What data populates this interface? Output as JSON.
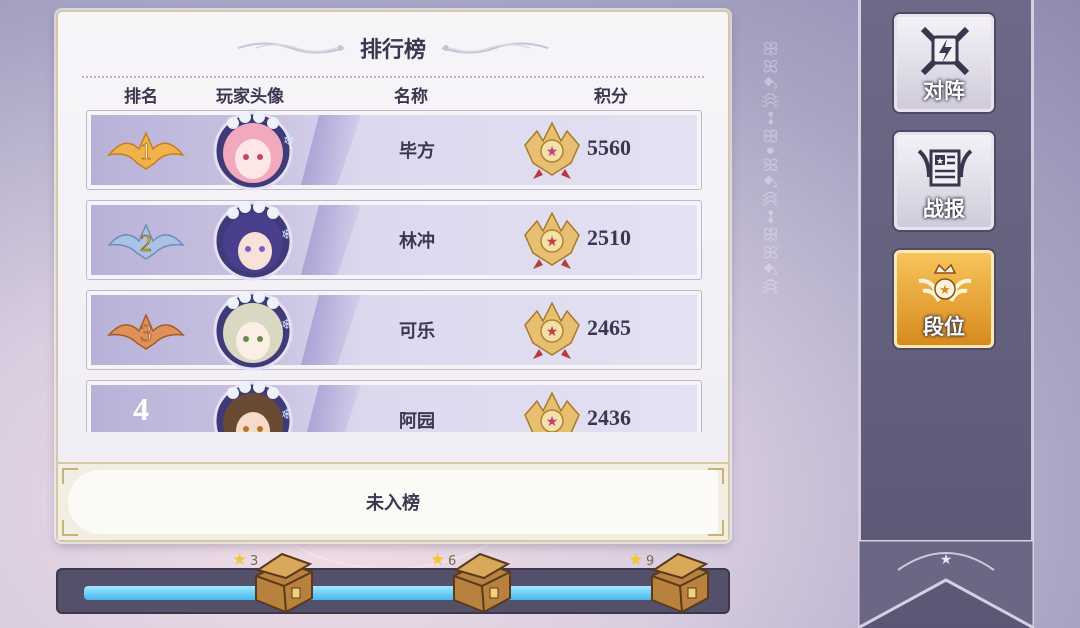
{
  "leaderboard": {
    "title": "排行榜",
    "columns": {
      "rank": "排名",
      "avatar": "玩家头像",
      "name": "名称",
      "score": "积分"
    },
    "rows": [
      {
        "rank": "1",
        "name": "毕方",
        "score": "5560",
        "badge_color": "#f0b24a",
        "hair_color": "#f2a8bd",
        "eye_color": "#c0486a"
      },
      {
        "rank": "2",
        "name": "林冲",
        "score": "2510",
        "badge_color": "#a9c3e8",
        "hair_color": "#4a3f8c",
        "eye_color": "#7a5cc8"
      },
      {
        "rank": "3",
        "name": "可乐",
        "score": "2465",
        "badge_color": "#e0915a",
        "hair_color": "#d9d8c2",
        "eye_color": "#6a8a4a"
      },
      {
        "rank": "4",
        "name": "阿园",
        "score": "2436",
        "badge_color": "",
        "hair_color": "#6a4a32",
        "eye_color": "#b5732c"
      }
    ],
    "self_status": "未入榜"
  },
  "progress": {
    "fraction": 0.93,
    "milestones": [
      {
        "stars": "3",
        "icon": "treasure-chest-icon"
      },
      {
        "stars": "6",
        "icon": "treasure-chest-icon"
      },
      {
        "stars": "9",
        "icon": "treasure-chest-icon"
      }
    ]
  },
  "sidebar": {
    "buttons": [
      {
        "label": "对阵",
        "icon": "crossed-swords-icon",
        "active": false
      },
      {
        "label": "战报",
        "icon": "battle-report-icon",
        "active": false
      },
      {
        "label": "段位",
        "icon": "rank-crown-icon",
        "active": true
      }
    ]
  },
  "colors": {
    "accent_gold": "#f2c63a",
    "active_tab": "#e9a233",
    "panel_border": "#d6c8a4",
    "progress_blue": "#49b6f0"
  }
}
